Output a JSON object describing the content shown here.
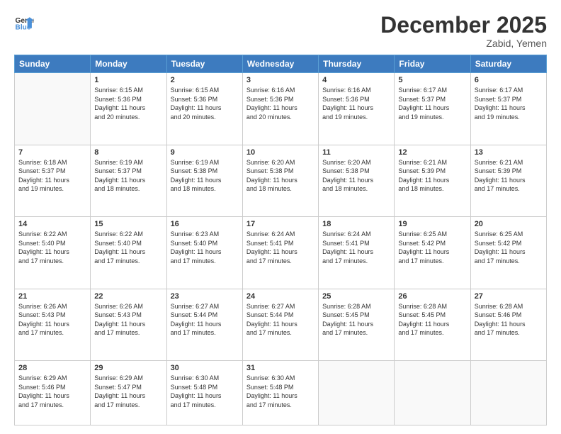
{
  "header": {
    "logo_general": "General",
    "logo_blue": "Blue",
    "month_title": "December 2025",
    "location": "Zabid, Yemen"
  },
  "days_of_week": [
    "Sunday",
    "Monday",
    "Tuesday",
    "Wednesday",
    "Thursday",
    "Friday",
    "Saturday"
  ],
  "weeks": [
    [
      {
        "day": "",
        "info": ""
      },
      {
        "day": "1",
        "info": "Sunrise: 6:15 AM\nSunset: 5:36 PM\nDaylight: 11 hours\nand 20 minutes."
      },
      {
        "day": "2",
        "info": "Sunrise: 6:15 AM\nSunset: 5:36 PM\nDaylight: 11 hours\nand 20 minutes."
      },
      {
        "day": "3",
        "info": "Sunrise: 6:16 AM\nSunset: 5:36 PM\nDaylight: 11 hours\nand 20 minutes."
      },
      {
        "day": "4",
        "info": "Sunrise: 6:16 AM\nSunset: 5:36 PM\nDaylight: 11 hours\nand 19 minutes."
      },
      {
        "day": "5",
        "info": "Sunrise: 6:17 AM\nSunset: 5:37 PM\nDaylight: 11 hours\nand 19 minutes."
      },
      {
        "day": "6",
        "info": "Sunrise: 6:17 AM\nSunset: 5:37 PM\nDaylight: 11 hours\nand 19 minutes."
      }
    ],
    [
      {
        "day": "7",
        "info": "Sunrise: 6:18 AM\nSunset: 5:37 PM\nDaylight: 11 hours\nand 19 minutes."
      },
      {
        "day": "8",
        "info": "Sunrise: 6:19 AM\nSunset: 5:37 PM\nDaylight: 11 hours\nand 18 minutes."
      },
      {
        "day": "9",
        "info": "Sunrise: 6:19 AM\nSunset: 5:38 PM\nDaylight: 11 hours\nand 18 minutes."
      },
      {
        "day": "10",
        "info": "Sunrise: 6:20 AM\nSunset: 5:38 PM\nDaylight: 11 hours\nand 18 minutes."
      },
      {
        "day": "11",
        "info": "Sunrise: 6:20 AM\nSunset: 5:38 PM\nDaylight: 11 hours\nand 18 minutes."
      },
      {
        "day": "12",
        "info": "Sunrise: 6:21 AM\nSunset: 5:39 PM\nDaylight: 11 hours\nand 18 minutes."
      },
      {
        "day": "13",
        "info": "Sunrise: 6:21 AM\nSunset: 5:39 PM\nDaylight: 11 hours\nand 17 minutes."
      }
    ],
    [
      {
        "day": "14",
        "info": "Sunrise: 6:22 AM\nSunset: 5:40 PM\nDaylight: 11 hours\nand 17 minutes."
      },
      {
        "day": "15",
        "info": "Sunrise: 6:22 AM\nSunset: 5:40 PM\nDaylight: 11 hours\nand 17 minutes."
      },
      {
        "day": "16",
        "info": "Sunrise: 6:23 AM\nSunset: 5:40 PM\nDaylight: 11 hours\nand 17 minutes."
      },
      {
        "day": "17",
        "info": "Sunrise: 6:24 AM\nSunset: 5:41 PM\nDaylight: 11 hours\nand 17 minutes."
      },
      {
        "day": "18",
        "info": "Sunrise: 6:24 AM\nSunset: 5:41 PM\nDaylight: 11 hours\nand 17 minutes."
      },
      {
        "day": "19",
        "info": "Sunrise: 6:25 AM\nSunset: 5:42 PM\nDaylight: 11 hours\nand 17 minutes."
      },
      {
        "day": "20",
        "info": "Sunrise: 6:25 AM\nSunset: 5:42 PM\nDaylight: 11 hours\nand 17 minutes."
      }
    ],
    [
      {
        "day": "21",
        "info": "Sunrise: 6:26 AM\nSunset: 5:43 PM\nDaylight: 11 hours\nand 17 minutes."
      },
      {
        "day": "22",
        "info": "Sunrise: 6:26 AM\nSunset: 5:43 PM\nDaylight: 11 hours\nand 17 minutes."
      },
      {
        "day": "23",
        "info": "Sunrise: 6:27 AM\nSunset: 5:44 PM\nDaylight: 11 hours\nand 17 minutes."
      },
      {
        "day": "24",
        "info": "Sunrise: 6:27 AM\nSunset: 5:44 PM\nDaylight: 11 hours\nand 17 minutes."
      },
      {
        "day": "25",
        "info": "Sunrise: 6:28 AM\nSunset: 5:45 PM\nDaylight: 11 hours\nand 17 minutes."
      },
      {
        "day": "26",
        "info": "Sunrise: 6:28 AM\nSunset: 5:45 PM\nDaylight: 11 hours\nand 17 minutes."
      },
      {
        "day": "27",
        "info": "Sunrise: 6:28 AM\nSunset: 5:46 PM\nDaylight: 11 hours\nand 17 minutes."
      }
    ],
    [
      {
        "day": "28",
        "info": "Sunrise: 6:29 AM\nSunset: 5:46 PM\nDaylight: 11 hours\nand 17 minutes."
      },
      {
        "day": "29",
        "info": "Sunrise: 6:29 AM\nSunset: 5:47 PM\nDaylight: 11 hours\nand 17 minutes."
      },
      {
        "day": "30",
        "info": "Sunrise: 6:30 AM\nSunset: 5:48 PM\nDaylight: 11 hours\nand 17 minutes."
      },
      {
        "day": "31",
        "info": "Sunrise: 6:30 AM\nSunset: 5:48 PM\nDaylight: 11 hours\nand 17 minutes."
      },
      {
        "day": "",
        "info": ""
      },
      {
        "day": "",
        "info": ""
      },
      {
        "day": "",
        "info": ""
      }
    ]
  ]
}
